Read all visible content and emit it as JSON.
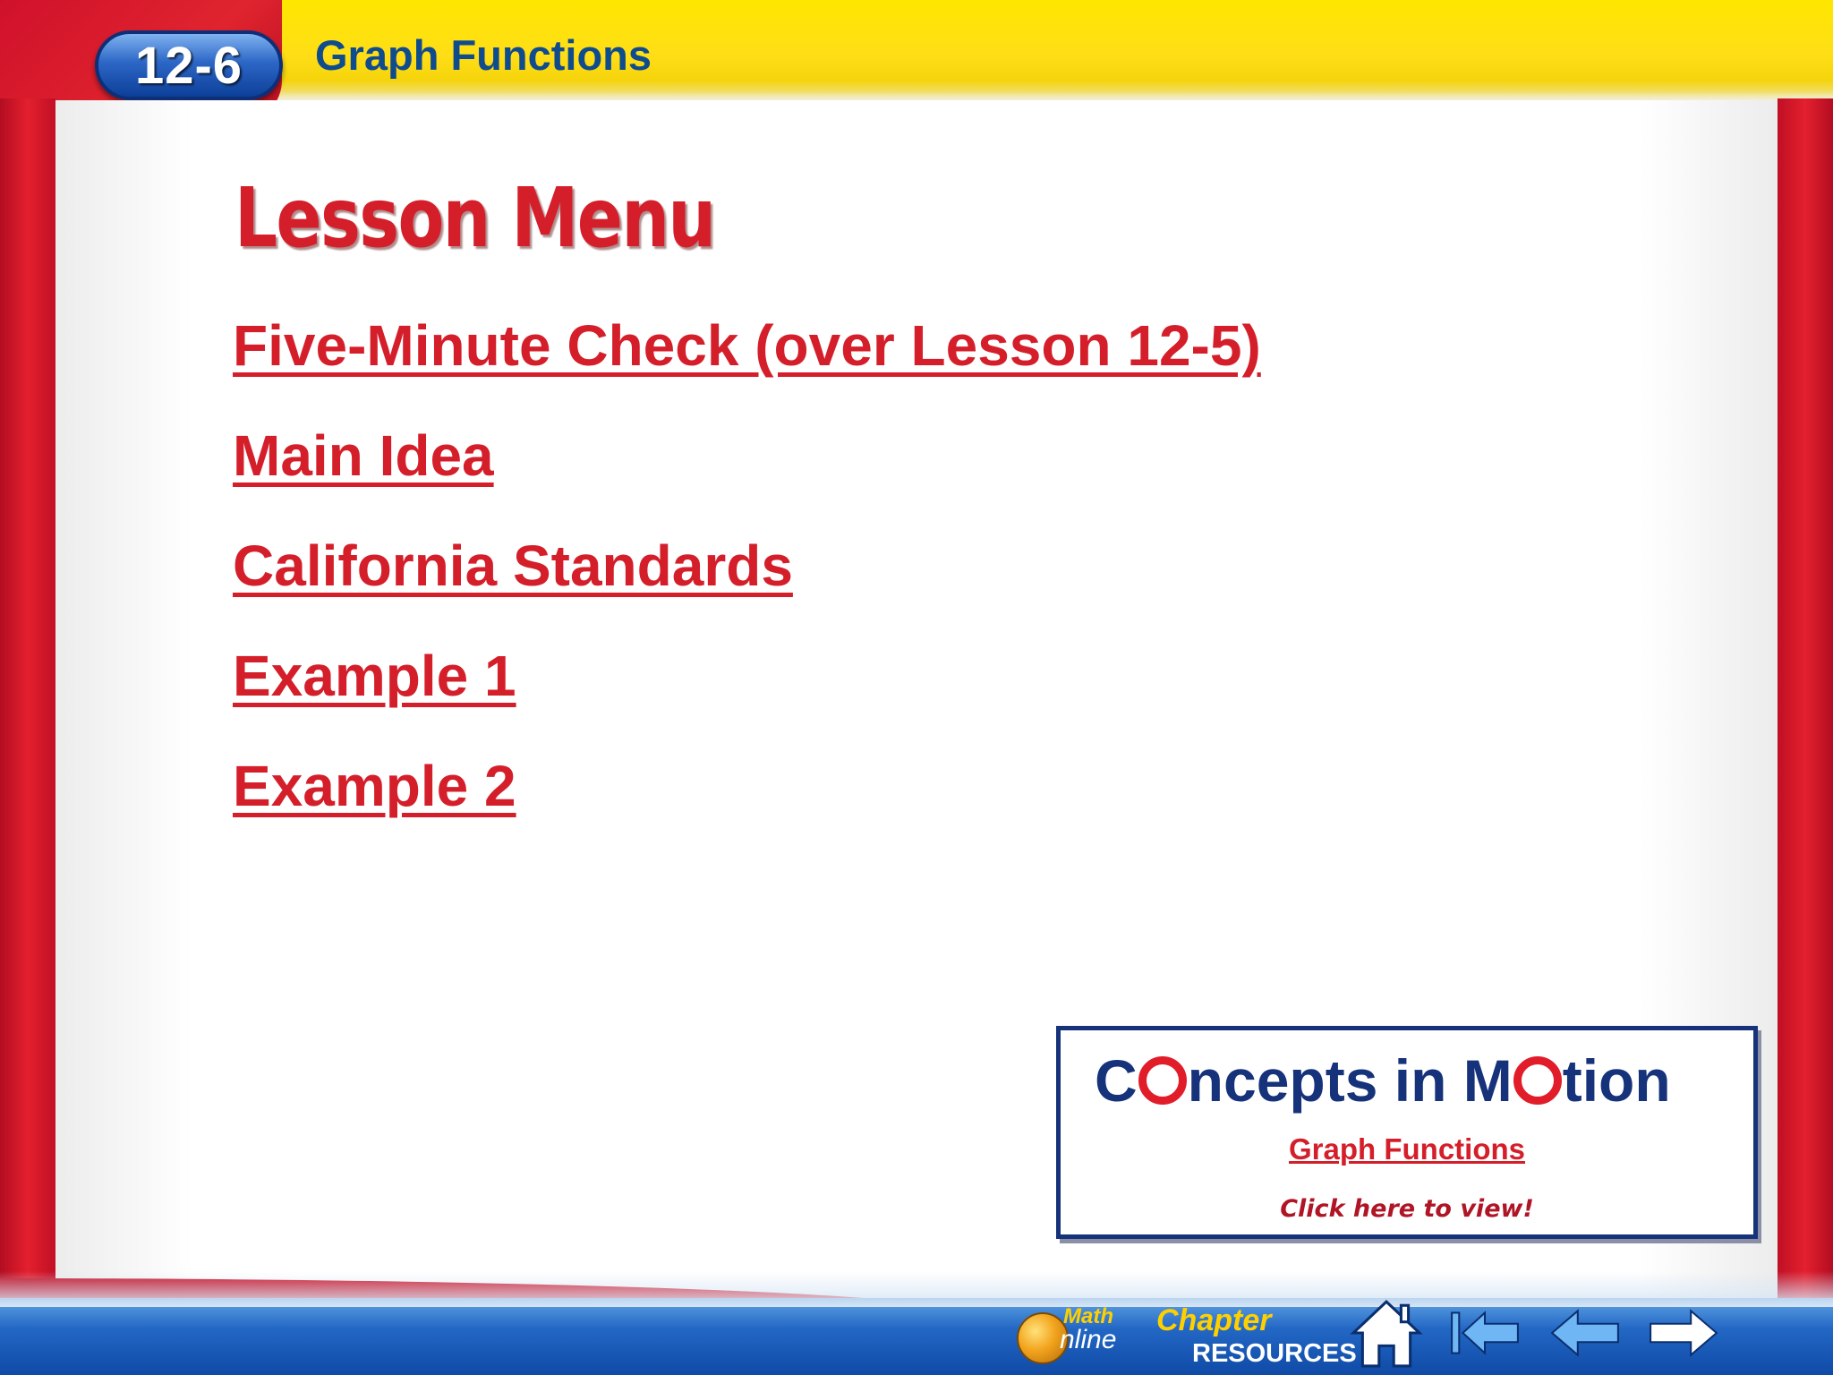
{
  "header": {
    "lesson_number": "12-6",
    "lesson_title": "Graph Functions"
  },
  "main": {
    "heading": "Lesson Menu",
    "menu_items": [
      {
        "label": "Five-Minute Check (over Lesson 12-5)"
      },
      {
        "label": "Main Idea"
      },
      {
        "label": "California Standards"
      },
      {
        "label": "Example 1"
      },
      {
        "label": "Example 2"
      }
    ]
  },
  "concepts_in_motion": {
    "title_prefix": "C",
    "title_mid": "ncepts in M",
    "title_suffix": "tion",
    "link_label": "Graph Functions",
    "cta": "Click here to view!"
  },
  "footer": {
    "math_online": {
      "line1": "Math",
      "line2": "nline"
    },
    "chapter_resources": {
      "line1": "Chapter",
      "line2": "RESOURCES"
    },
    "icons": [
      "home-icon",
      "first-slide-icon",
      "previous-slide-icon",
      "next-slide-icon"
    ]
  },
  "colors": {
    "frame_red": "#e3202e",
    "banner_yellow": "#ffe600",
    "link_red": "#d41f2b",
    "title_blue": "#0f4c8e",
    "bar_blue": "#2367c5"
  }
}
